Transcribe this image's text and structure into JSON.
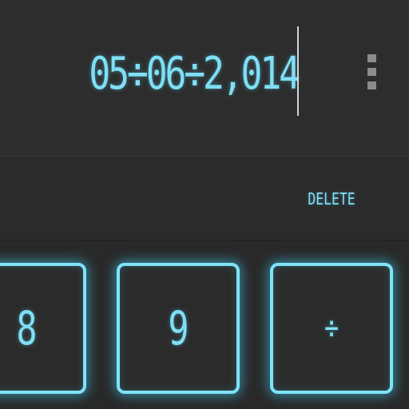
{
  "display": {
    "expression": "05÷06÷2,014"
  },
  "delete_row": {
    "delete_label": "DELETE"
  },
  "keypad": {
    "keys": [
      {
        "label": "8"
      },
      {
        "label": "9"
      },
      {
        "label": "÷"
      }
    ]
  },
  "colors": {
    "accent": "#7fdff5",
    "background": "#2b2b2b",
    "menu_dots": "#8c8c8c"
  },
  "icons": {
    "menu": "overflow-menu-icon"
  }
}
